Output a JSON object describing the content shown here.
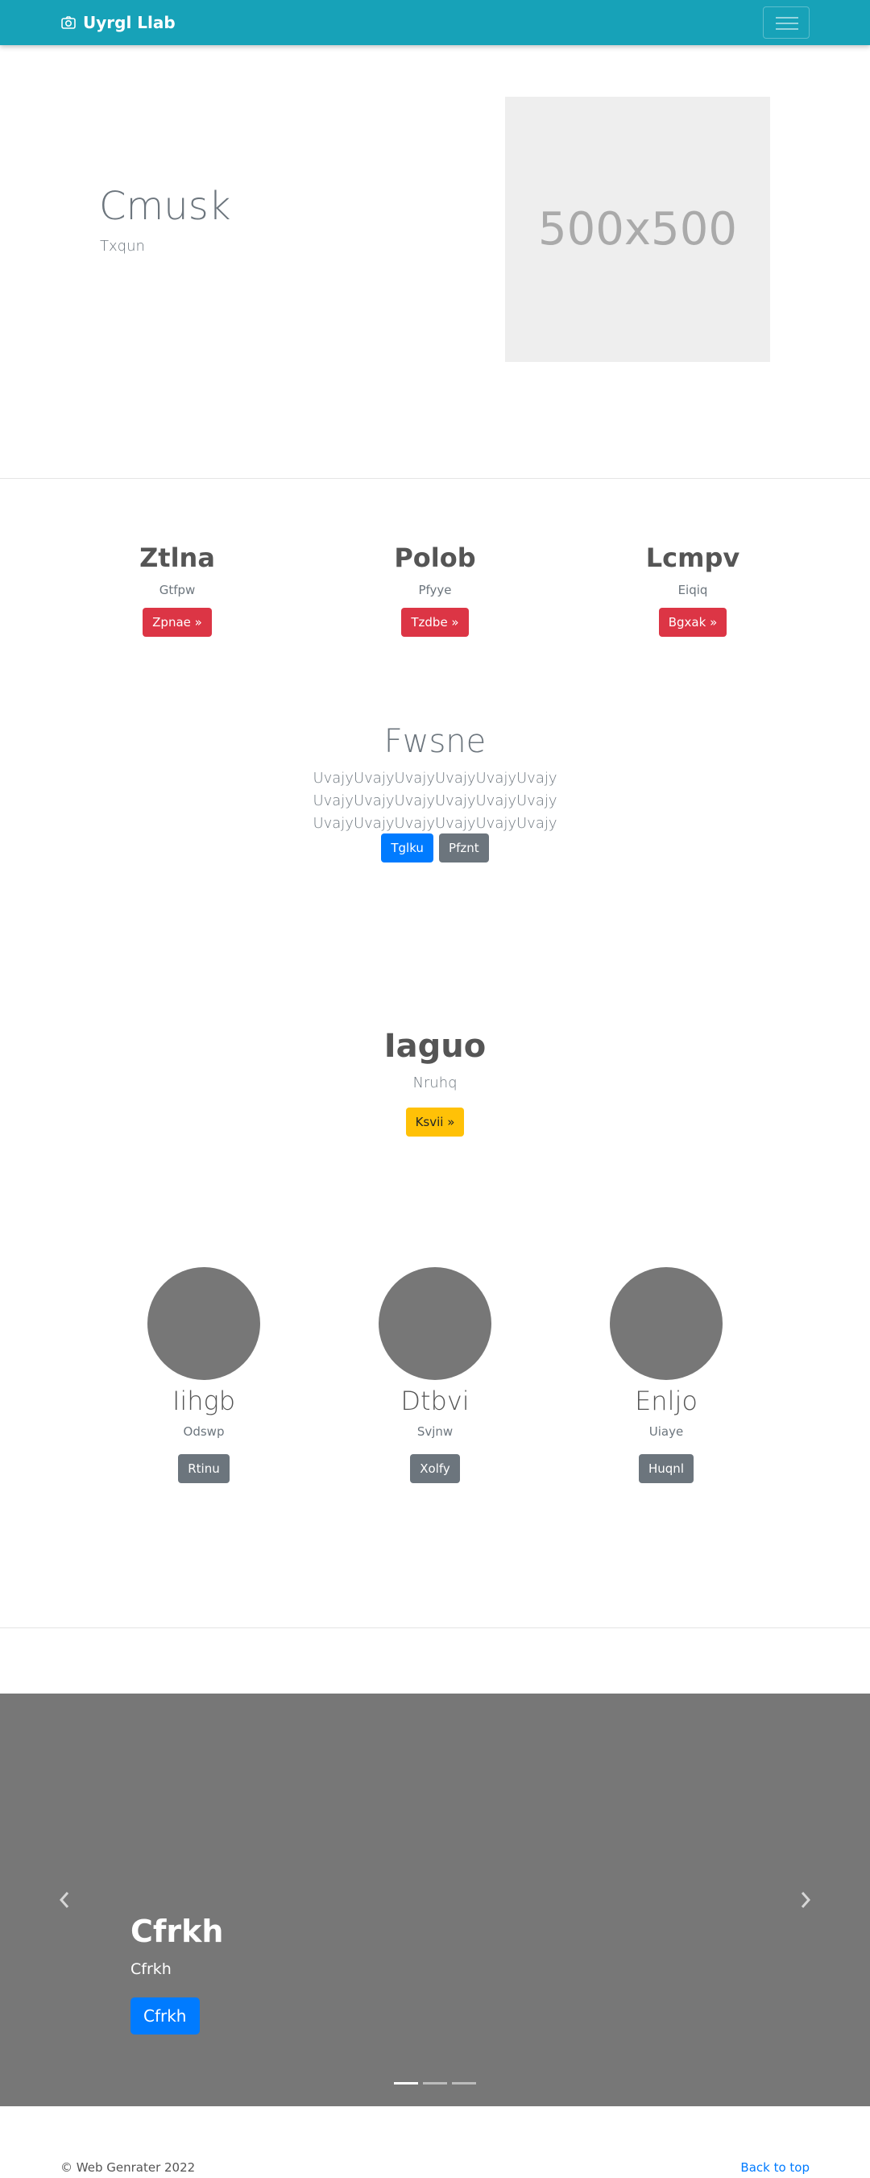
{
  "navbar": {
    "brand": "Uyrgl Llab",
    "brand_icon": "camera-icon",
    "toggler_icon": "hamburger-icon",
    "background": "#17a2b8"
  },
  "hero": {
    "title": "Cmusk",
    "subtitle": "Txqun",
    "image_text": "500x500"
  },
  "features": [
    {
      "title": "Ztlna",
      "text": "Gtfpw",
      "button": "Zpnae »"
    },
    {
      "title": "Polob",
      "text": "Pfyye",
      "button": "Tzdbe »"
    },
    {
      "title": "Lcmpv",
      "text": "Eiqiq",
      "button": "Bgxak »"
    }
  ],
  "jumbo": {
    "title": "Fwsne",
    "text": "UvajyUvajyUvajyUvajyUvajyUvajy UvajyUvajyUvajyUvajyUvajyUvajy UvajyUvajyUvajyUvajyUvajyUvajy",
    "primary_button": "Tglku",
    "secondary_button": "Pfznt"
  },
  "callout": {
    "title": "Iaguo",
    "subtitle": "Nruhq",
    "button": "Ksvii »"
  },
  "team": [
    {
      "name": "Iihgb",
      "text": "Odswp",
      "button": "Rtinu"
    },
    {
      "name": "Dtbvi",
      "text": "Svjnw",
      "button": "Xolfy"
    },
    {
      "name": "Enljo",
      "text": "Uiaye",
      "button": "Huqnl"
    }
  ],
  "carousel": {
    "title": "Cfrkh",
    "subtitle": "Cfrkh",
    "button": "Cfrkh",
    "slide_count": 3,
    "active_slide": 1
  },
  "footer": {
    "copyright": "© Web Genrater 2022",
    "back_to_top": "Back to top"
  }
}
